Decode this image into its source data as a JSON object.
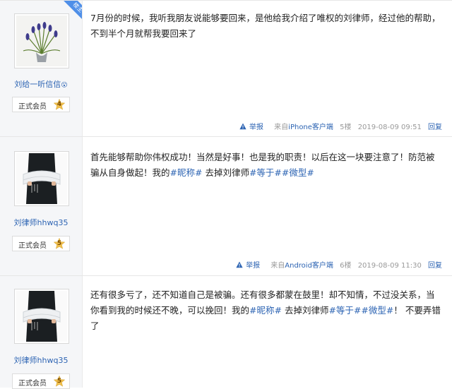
{
  "posts": [
    {
      "author": "刘给一听信信",
      "author_emoji": "😮",
      "op_badge": "楼主",
      "rank_label": "正式会员",
      "rank_level": "4",
      "content_parts": [
        {
          "text": "7月份的时候，我听我朋友说能够要回来，是他给我介绍了唯权的刘律师，经过他的帮助，不到半个月就帮我要回来了"
        }
      ],
      "report": "举报",
      "from_label": "来自",
      "client": "iPhone客户端",
      "floor": "5楼",
      "time": "2019-08-09 09:51",
      "reply": "回复"
    },
    {
      "author": "刘律师hhwq35",
      "rank_label": "正式会员",
      "rank_level": "5",
      "content_parts": [
        {
          "text": "首先能够帮助你伟权成功！当然是好事！也是我的职责！以后在这一块要注意了！防范被骗从自身做起！我的"
        },
        {
          "text": "#昵称#",
          "tag": true
        },
        {
          "text": " 去掉刘律师"
        },
        {
          "text": "#等于#",
          "tag": true
        },
        {
          "text": "#微型#",
          "tag": true
        }
      ],
      "report": "举报",
      "from_label": "来自",
      "client": "Android客户端",
      "floor": "6楼",
      "time": "2019-08-09 11:30",
      "reply": "回复"
    },
    {
      "author": "刘律师hhwq35",
      "rank_label": "正式会员",
      "rank_level": "5",
      "content_parts": [
        {
          "text": "还有很多亏了，还不知道自己是被骗。还有很多都蒙在鼓里！却不知情，不过没关系，当你看到我的时候还不晚，可以挽回！我的"
        },
        {
          "text": "#昵称#",
          "tag": true
        },
        {
          "text": " 去掉刘律师"
        },
        {
          "text": "#等于#",
          "tag": true
        },
        {
          "text": "#微型#",
          "tag": true
        },
        {
          "text": "！ 不要弄错了"
        }
      ]
    }
  ],
  "colors": {
    "link": "#2d64b3",
    "sidebar_bg": "#f5f6f8",
    "badge": "#4f8fe8",
    "rank_star": "#f2c14e"
  }
}
